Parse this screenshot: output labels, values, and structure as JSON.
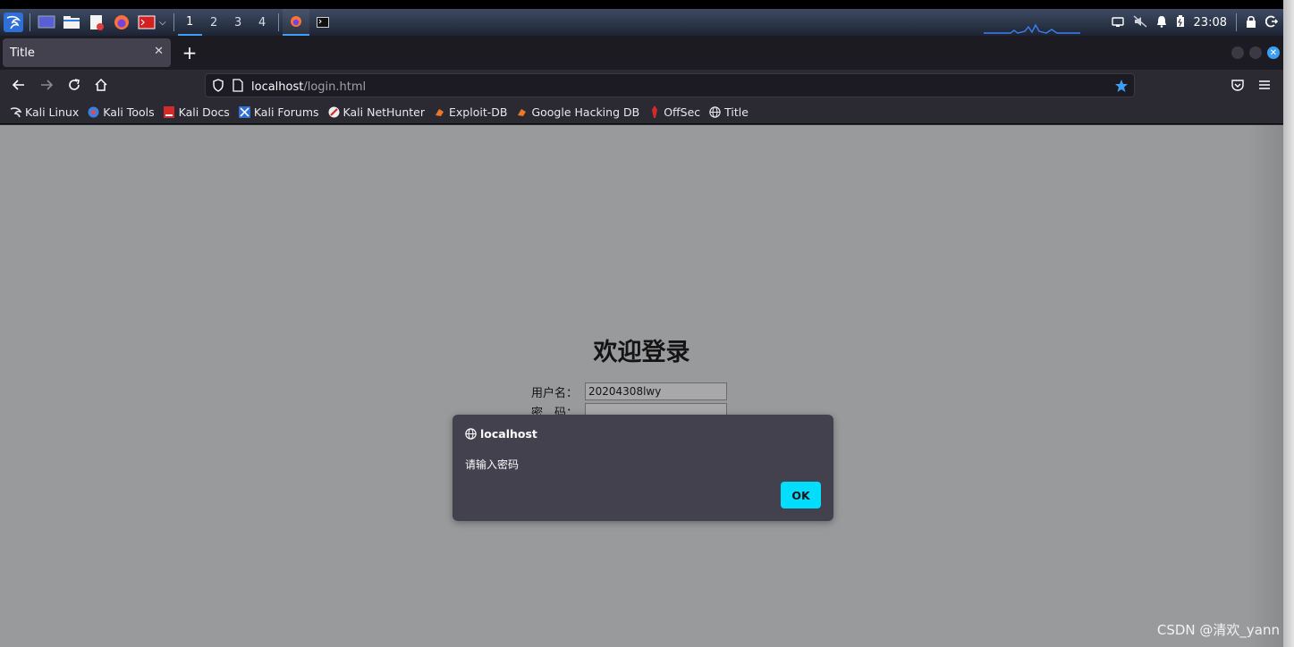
{
  "os_panel": {
    "workspaces": [
      "1",
      "2",
      "3",
      "4"
    ],
    "active_workspace": "1",
    "clock": "23:08",
    "accent": "#3d9ef5"
  },
  "browser": {
    "tab_title": "Title",
    "url_host": "localhost",
    "url_path": "/login.html",
    "bookmarks": [
      {
        "label": "Kali Linux",
        "icon": "kali-dragon-icon"
      },
      {
        "label": "Kali Tools",
        "icon": "kali-tools-icon"
      },
      {
        "label": "Kali Docs",
        "icon": "kali-docs-icon"
      },
      {
        "label": "Kali Forums",
        "icon": "kali-forums-icon"
      },
      {
        "label": "Kali NetHunter",
        "icon": "nethunter-icon"
      },
      {
        "label": "Exploit-DB",
        "icon": "exploit-db-icon"
      },
      {
        "label": "Google Hacking DB",
        "icon": "ghdb-icon"
      },
      {
        "label": "OffSec",
        "icon": "offsec-icon"
      },
      {
        "label": "Title",
        "icon": "globe-icon"
      }
    ]
  },
  "page": {
    "heading": "欢迎登录",
    "username_label": "用户名：",
    "username_value": "20204308lwy",
    "password_label": "密　码："
  },
  "dialog": {
    "origin": "localhost",
    "message": "请输入密码",
    "ok_label": "OK",
    "ok_color": "#00ddff"
  },
  "watermark": "CSDN @清欢_yann"
}
